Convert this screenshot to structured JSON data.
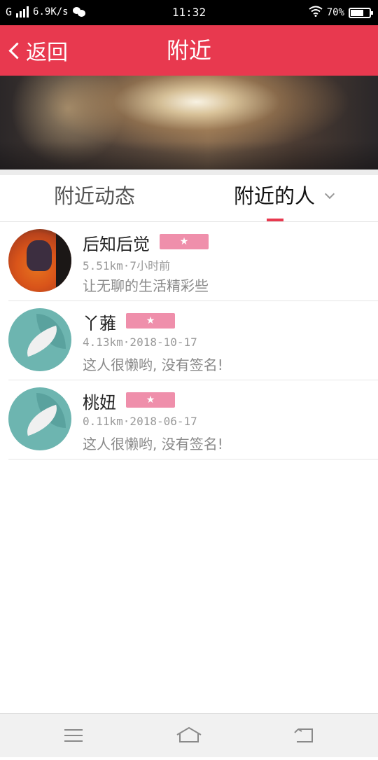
{
  "status_bar": {
    "network": "G",
    "speed": "6.9K/s",
    "time": "11:32",
    "battery_text": "70%",
    "battery_level": 0.7
  },
  "header": {
    "back_label": "返回",
    "title": "附近"
  },
  "tabs": [
    {
      "label": "附近动态",
      "selected": false
    },
    {
      "label": "附近的人",
      "selected": true
    }
  ],
  "users": [
    {
      "name": "后知后觉",
      "badge": "★",
      "meta": "5.51km·7小时前",
      "signature": "让无聊的生活精彩些",
      "avatar": "photo"
    },
    {
      "name": "丫蕥",
      "badge": "★",
      "meta": "4.13km·2018-10-17",
      "signature": "这人很懒哟, 没有签名!",
      "avatar": "leaf"
    },
    {
      "name": "桃妞",
      "badge": "★",
      "meta": "0.11km·2018-06-17",
      "signature": "这人很懒哟, 没有签名!",
      "avatar": "leaf"
    }
  ],
  "nav": {
    "icons": [
      "menu-icon",
      "home-icon",
      "back-icon"
    ]
  },
  "colors": {
    "accent": "#e8394f",
    "badge": "#ef8fab",
    "leaf_avatar": "#6db5b0"
  }
}
